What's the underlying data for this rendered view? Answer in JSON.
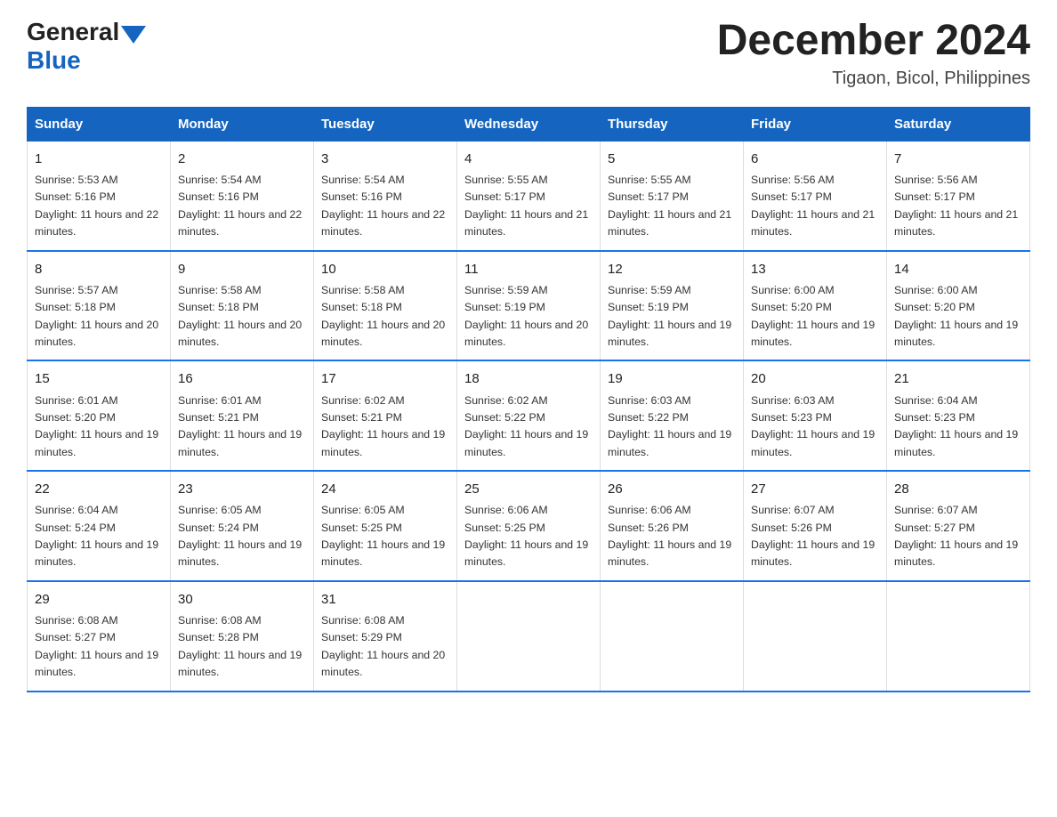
{
  "header": {
    "logo_general": "General",
    "logo_blue": "Blue",
    "month_year": "December 2024",
    "location": "Tigaon, Bicol, Philippines"
  },
  "weekdays": [
    "Sunday",
    "Monday",
    "Tuesday",
    "Wednesday",
    "Thursday",
    "Friday",
    "Saturday"
  ],
  "weeks": [
    [
      {
        "day": "1",
        "sunrise": "5:53 AM",
        "sunset": "5:16 PM",
        "daylight": "11 hours and 22 minutes."
      },
      {
        "day": "2",
        "sunrise": "5:54 AM",
        "sunset": "5:16 PM",
        "daylight": "11 hours and 22 minutes."
      },
      {
        "day": "3",
        "sunrise": "5:54 AM",
        "sunset": "5:16 PM",
        "daylight": "11 hours and 22 minutes."
      },
      {
        "day": "4",
        "sunrise": "5:55 AM",
        "sunset": "5:17 PM",
        "daylight": "11 hours and 21 minutes."
      },
      {
        "day": "5",
        "sunrise": "5:55 AM",
        "sunset": "5:17 PM",
        "daylight": "11 hours and 21 minutes."
      },
      {
        "day": "6",
        "sunrise": "5:56 AM",
        "sunset": "5:17 PM",
        "daylight": "11 hours and 21 minutes."
      },
      {
        "day": "7",
        "sunrise": "5:56 AM",
        "sunset": "5:17 PM",
        "daylight": "11 hours and 21 minutes."
      }
    ],
    [
      {
        "day": "8",
        "sunrise": "5:57 AM",
        "sunset": "5:18 PM",
        "daylight": "11 hours and 20 minutes."
      },
      {
        "day": "9",
        "sunrise": "5:58 AM",
        "sunset": "5:18 PM",
        "daylight": "11 hours and 20 minutes."
      },
      {
        "day": "10",
        "sunrise": "5:58 AM",
        "sunset": "5:18 PM",
        "daylight": "11 hours and 20 minutes."
      },
      {
        "day": "11",
        "sunrise": "5:59 AM",
        "sunset": "5:19 PM",
        "daylight": "11 hours and 20 minutes."
      },
      {
        "day": "12",
        "sunrise": "5:59 AM",
        "sunset": "5:19 PM",
        "daylight": "11 hours and 19 minutes."
      },
      {
        "day": "13",
        "sunrise": "6:00 AM",
        "sunset": "5:20 PM",
        "daylight": "11 hours and 19 minutes."
      },
      {
        "day": "14",
        "sunrise": "6:00 AM",
        "sunset": "5:20 PM",
        "daylight": "11 hours and 19 minutes."
      }
    ],
    [
      {
        "day": "15",
        "sunrise": "6:01 AM",
        "sunset": "5:20 PM",
        "daylight": "11 hours and 19 minutes."
      },
      {
        "day": "16",
        "sunrise": "6:01 AM",
        "sunset": "5:21 PM",
        "daylight": "11 hours and 19 minutes."
      },
      {
        "day": "17",
        "sunrise": "6:02 AM",
        "sunset": "5:21 PM",
        "daylight": "11 hours and 19 minutes."
      },
      {
        "day": "18",
        "sunrise": "6:02 AM",
        "sunset": "5:22 PM",
        "daylight": "11 hours and 19 minutes."
      },
      {
        "day": "19",
        "sunrise": "6:03 AM",
        "sunset": "5:22 PM",
        "daylight": "11 hours and 19 minutes."
      },
      {
        "day": "20",
        "sunrise": "6:03 AM",
        "sunset": "5:23 PM",
        "daylight": "11 hours and 19 minutes."
      },
      {
        "day": "21",
        "sunrise": "6:04 AM",
        "sunset": "5:23 PM",
        "daylight": "11 hours and 19 minutes."
      }
    ],
    [
      {
        "day": "22",
        "sunrise": "6:04 AM",
        "sunset": "5:24 PM",
        "daylight": "11 hours and 19 minutes."
      },
      {
        "day": "23",
        "sunrise": "6:05 AM",
        "sunset": "5:24 PM",
        "daylight": "11 hours and 19 minutes."
      },
      {
        "day": "24",
        "sunrise": "6:05 AM",
        "sunset": "5:25 PM",
        "daylight": "11 hours and 19 minutes."
      },
      {
        "day": "25",
        "sunrise": "6:06 AM",
        "sunset": "5:25 PM",
        "daylight": "11 hours and 19 minutes."
      },
      {
        "day": "26",
        "sunrise": "6:06 AM",
        "sunset": "5:26 PM",
        "daylight": "11 hours and 19 minutes."
      },
      {
        "day": "27",
        "sunrise": "6:07 AM",
        "sunset": "5:26 PM",
        "daylight": "11 hours and 19 minutes."
      },
      {
        "day": "28",
        "sunrise": "6:07 AM",
        "sunset": "5:27 PM",
        "daylight": "11 hours and 19 minutes."
      }
    ],
    [
      {
        "day": "29",
        "sunrise": "6:08 AM",
        "sunset": "5:27 PM",
        "daylight": "11 hours and 19 minutes."
      },
      {
        "day": "30",
        "sunrise": "6:08 AM",
        "sunset": "5:28 PM",
        "daylight": "11 hours and 19 minutes."
      },
      {
        "day": "31",
        "sunrise": "6:08 AM",
        "sunset": "5:29 PM",
        "daylight": "11 hours and 20 minutes."
      },
      null,
      null,
      null,
      null
    ]
  ]
}
